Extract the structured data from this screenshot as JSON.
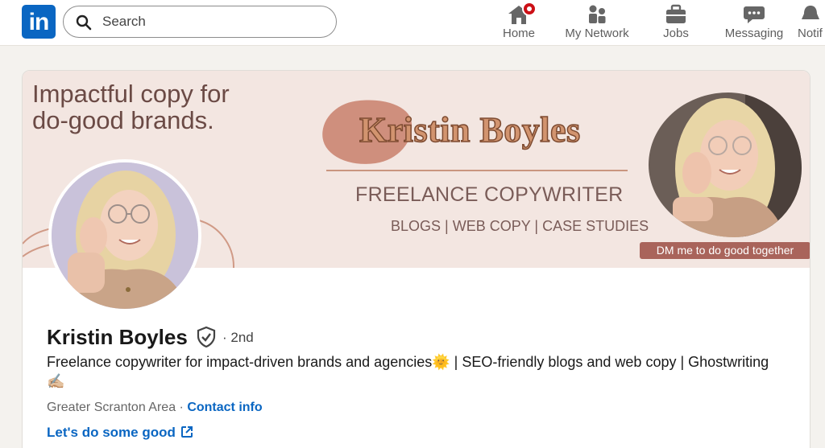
{
  "nav": {
    "logo": "in",
    "search_placeholder": "Search",
    "items": [
      {
        "label": "Home",
        "icon": "home-icon"
      },
      {
        "label": "My Network",
        "icon": "people-icon"
      },
      {
        "label": "Jobs",
        "icon": "briefcase-icon"
      },
      {
        "label": "Messaging",
        "icon": "chat-icon"
      },
      {
        "label": "Notif",
        "icon": "bell-icon"
      }
    ]
  },
  "banner": {
    "tagline_line1": "Impactful copy for",
    "tagline_line2": "do-good brands.",
    "name": "Kristin Boyles",
    "title": "FREELANCE COPYWRITER",
    "services": "BLOGS | WEB COPY | CASE STUDIES",
    "dm": "DM me to do good together"
  },
  "profile": {
    "name": "Kristin Boyles",
    "degree": "· 2nd",
    "headline": "Freelance copywriter for impact-driven brands and agencies🌞 | SEO-friendly blogs and web copy | Ghostwriting✍🏼",
    "location": "Greater Scranton Area ·",
    "contact_label": "Contact info",
    "website_label": "Let's do some good"
  },
  "colors": {
    "brand": "#0a66c2",
    "banner_bg": "#f3e6e1",
    "accent": "#a9645b"
  }
}
